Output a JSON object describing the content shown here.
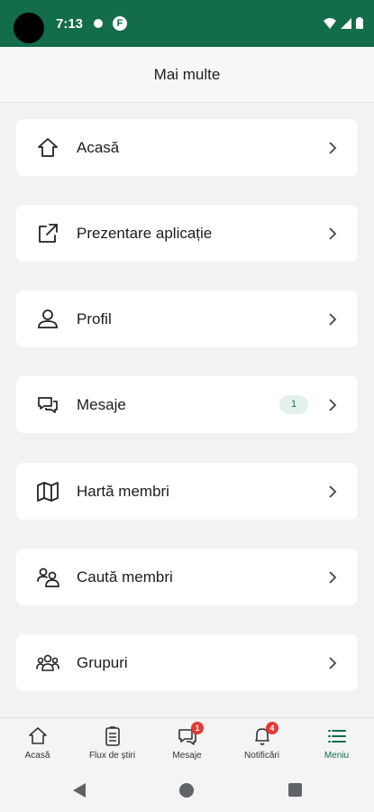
{
  "status_bar": {
    "time": "7:13",
    "app_notif_glyph": "F"
  },
  "header": {
    "title": "Mai multe"
  },
  "menu": {
    "items": [
      {
        "icon": "home-icon",
        "label": "Acasă"
      },
      {
        "icon": "external-link-icon",
        "label": "Prezentare aplicație"
      },
      {
        "icon": "user-icon",
        "label": "Profil"
      },
      {
        "icon": "chat-icon",
        "label": "Mesaje",
        "count": "1"
      },
      {
        "icon": "map-icon",
        "label": "Hartă membri"
      },
      {
        "icon": "users-search-icon",
        "label": "Caută membri"
      },
      {
        "icon": "groups-icon",
        "label": "Grupuri"
      }
    ]
  },
  "tab_bar": {
    "tabs": [
      {
        "icon": "home-icon",
        "label": "Acasă"
      },
      {
        "icon": "news-feed-icon",
        "label": "Flux de știri"
      },
      {
        "icon": "chat-icon",
        "label": "Mesaje",
        "badge": "1"
      },
      {
        "icon": "bell-icon",
        "label": "Notificări",
        "badge": "4"
      },
      {
        "icon": "menu-icon",
        "label": "Meniu",
        "active": true
      }
    ]
  },
  "colors": {
    "brand": "#136c4a",
    "badge_red": "#e53935",
    "count_bg": "#e2f1ec"
  }
}
